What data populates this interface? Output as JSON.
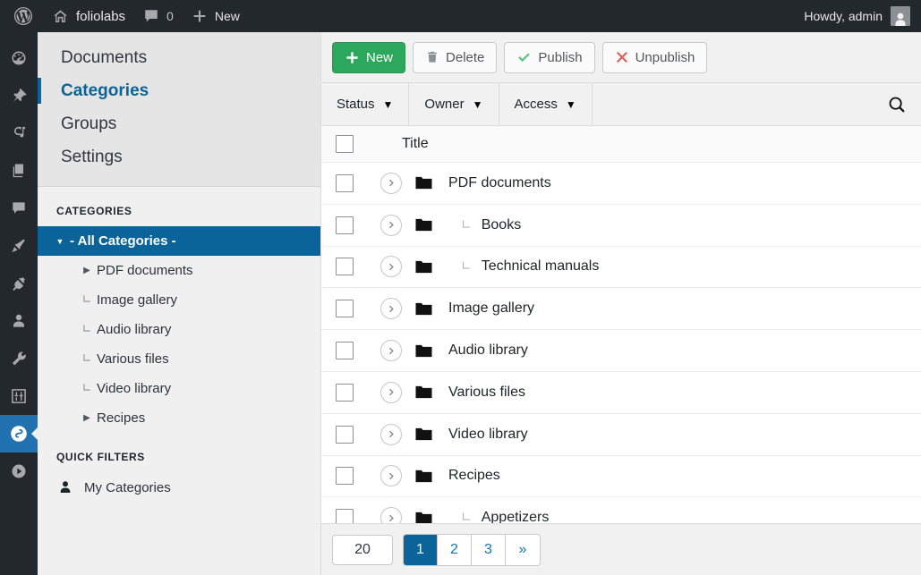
{
  "adminbar": {
    "logo_icon": "wordpress-logo-icon",
    "home_icon": "home-icon",
    "site_name": "foliolabs",
    "comments_icon": "comment-icon",
    "comments_count": "0",
    "new_icon": "plus-icon",
    "new_label": "New",
    "greeting": "Howdy, admin",
    "avatar_icon": "avatar-icon"
  },
  "rail": {
    "items": [
      {
        "icon": "dashboard-icon",
        "active": false
      },
      {
        "icon": "pin-posts-icon",
        "active": false
      },
      {
        "icon": "media-icon",
        "active": false
      },
      {
        "icon": "pages-icon",
        "active": false
      },
      {
        "icon": "comments-icon",
        "active": false
      },
      {
        "icon": "appearance-brush-icon",
        "active": false
      },
      {
        "icon": "plugins-plug-icon",
        "active": false
      },
      {
        "icon": "users-icon",
        "active": false
      },
      {
        "icon": "tools-wrench-icon",
        "active": false
      },
      {
        "icon": "settings-sliders-icon",
        "active": false
      },
      {
        "icon": "foliolabs-swirl-icon",
        "active": true
      },
      {
        "icon": "play-circle-icon",
        "active": false
      }
    ]
  },
  "leftpanel": {
    "nav": [
      {
        "label": "Documents",
        "active": false
      },
      {
        "label": "Categories",
        "active": true
      },
      {
        "label": "Groups",
        "active": false
      },
      {
        "label": "Settings",
        "active": false
      }
    ],
    "categories_heading": "CATEGORIES",
    "tree": [
      {
        "label": "- All Categories -",
        "marker": "caret-down",
        "active": true,
        "indent": 0
      },
      {
        "label": "PDF documents",
        "marker": "caret-right",
        "active": false,
        "indent": 1
      },
      {
        "label": "Image gallery",
        "marker": "leaf",
        "active": false,
        "indent": 1
      },
      {
        "label": "Audio library",
        "marker": "leaf",
        "active": false,
        "indent": 1
      },
      {
        "label": "Various files",
        "marker": "leaf",
        "active": false,
        "indent": 1
      },
      {
        "label": "Video library",
        "marker": "leaf",
        "active": false,
        "indent": 1
      },
      {
        "label": "Recipes",
        "marker": "caret-right",
        "active": false,
        "indent": 1
      }
    ],
    "quick_filters_heading": "QUICK FILTERS",
    "quick_filters": [
      {
        "label": "My Categories",
        "icon": "user-icon"
      }
    ]
  },
  "toolbar": {
    "new_label": "New",
    "new_icon": "plus-icon",
    "delete_label": "Delete",
    "delete_icon": "trash-icon",
    "publish_label": "Publish",
    "publish_icon": "check-icon",
    "unpublish_label": "Unpublish",
    "unpublish_icon": "cross-icon"
  },
  "filters": {
    "status_label": "Status",
    "owner_label": "Owner",
    "access_label": "Access",
    "caret_icon": "chevron-down-icon",
    "search_icon": "search-icon"
  },
  "table": {
    "header_title": "Title",
    "row_chevron_icon": "chevron-right-circle-icon",
    "row_folder_icon": "folder-icon",
    "rows": [
      {
        "title": "PDF documents",
        "indent": 0
      },
      {
        "title": "Books",
        "indent": 1
      },
      {
        "title": "Technical manuals",
        "indent": 1
      },
      {
        "title": "Image gallery",
        "indent": 0
      },
      {
        "title": "Audio library",
        "indent": 0
      },
      {
        "title": "Various files",
        "indent": 0
      },
      {
        "title": "Video library",
        "indent": 0
      },
      {
        "title": "Recipes",
        "indent": 0
      },
      {
        "title": "Appetizers",
        "indent": 1
      }
    ]
  },
  "pagination": {
    "per_page": "20",
    "pages": [
      "1",
      "2",
      "3"
    ],
    "active_page": "1",
    "next_label": "»"
  },
  "colors": {
    "accent_blue": "#0a6499",
    "rail_active_blue": "#2271b1",
    "green": "#2ca85c",
    "red": "#d96459",
    "dark": "#23282d"
  }
}
